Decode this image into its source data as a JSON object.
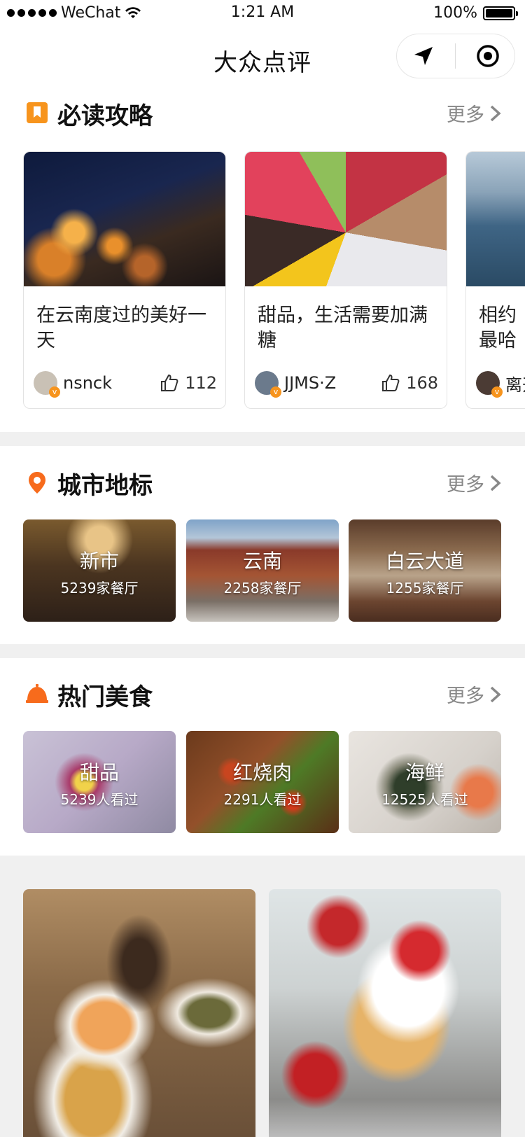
{
  "status": {
    "carrier": "WeChat",
    "time": "1:21 AM",
    "battery": "100%",
    "battery_level": 1.0
  },
  "nav": {
    "title": "大众点评"
  },
  "guides": {
    "title": "必读攻略",
    "more": "更多",
    "cards": [
      {
        "title": "在云南度过的美好一天",
        "author": "nsnck",
        "likes": "112"
      },
      {
        "title": "甜品，生活需要加满糖",
        "author": "JJMS·Z",
        "likes": "168"
      },
      {
        "title": "相约最哈哈呵",
        "author": "离开",
        "likes": ""
      }
    ]
  },
  "landmarks": {
    "title": "城市地标",
    "more": "更多",
    "items": [
      {
        "name": "新市",
        "count": "5239家餐厅"
      },
      {
        "name": "云南",
        "count": "2258家餐厅"
      },
      {
        "name": "白云大道",
        "count": "1255家餐厅"
      }
    ]
  },
  "hot_food": {
    "title": "热门美食",
    "more": "更多",
    "items": [
      {
        "name": "甜品",
        "count": "5239人看过"
      },
      {
        "name": "红烧肉",
        "count": "2291人看过"
      },
      {
        "name": "海鲜",
        "count": "12525人看过"
      }
    ]
  },
  "colors": {
    "accent": "#f7941d",
    "pin": "#f76b1c",
    "band": "#f0f0f0"
  }
}
